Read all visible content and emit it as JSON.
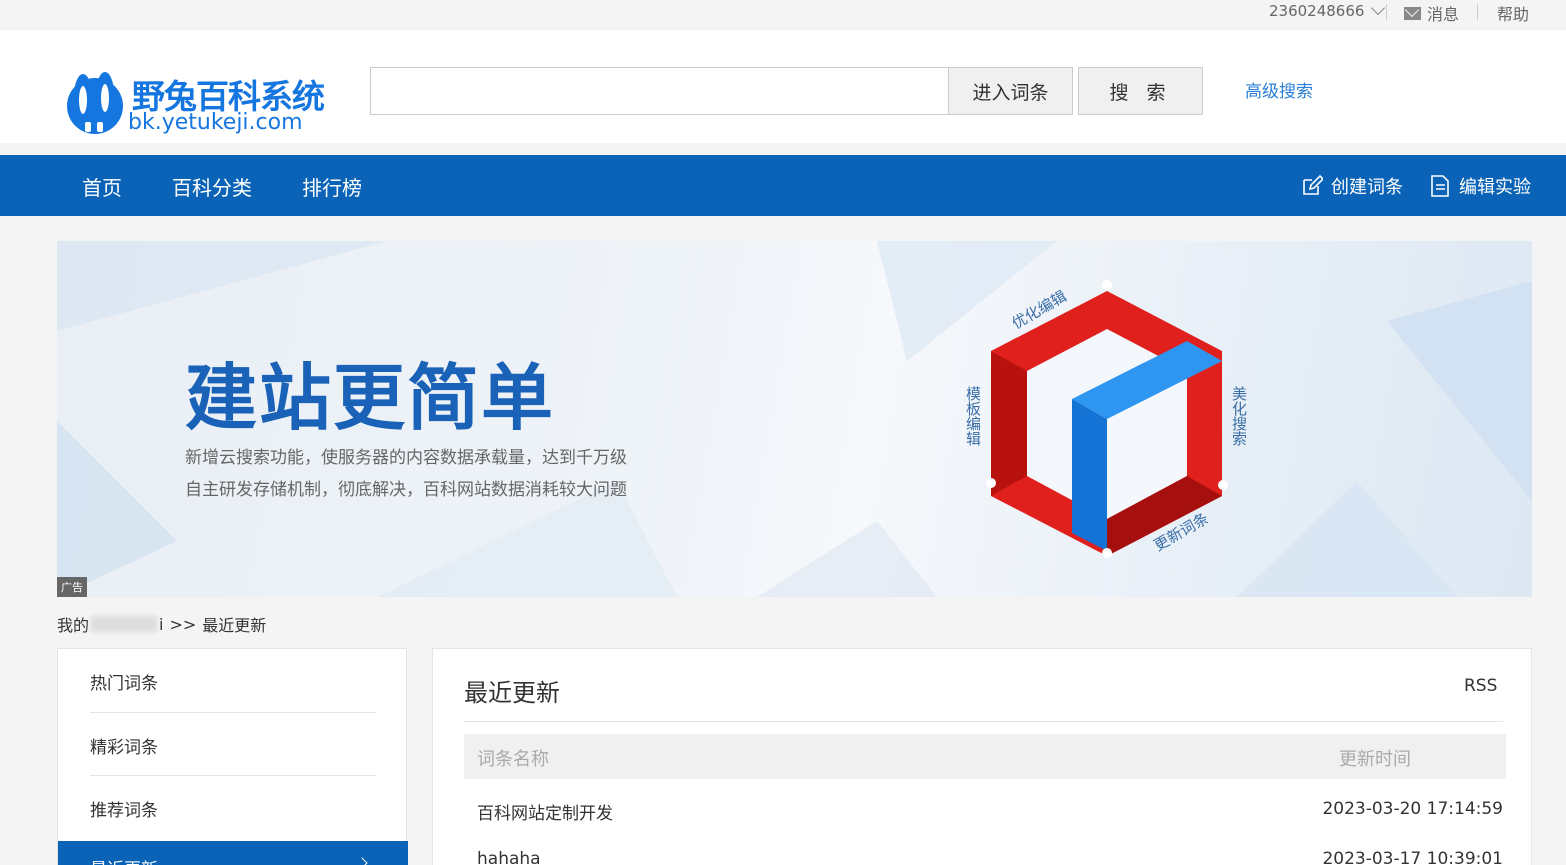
{
  "topbar": {
    "user_id": "2360248666",
    "messages": "消息",
    "help": "帮助"
  },
  "header": {
    "logo_title": "野兔百科系统",
    "logo_domain": "bk.yetukeji.com",
    "search_value": "",
    "enter_entry_label": "进入词条",
    "search_label": "搜 索",
    "advanced_search_label": "高级搜索"
  },
  "nav": {
    "items": [
      "首页",
      "百科分类",
      "排行榜"
    ],
    "create_entry": "创建词条",
    "edit_lab": "编辑实验"
  },
  "banner": {
    "headline": "建站更简单",
    "line1": "新增云搜索功能，使服务器的内容数据承载量，达到千万级",
    "line2": "自主研发存储机制，彻底解决，百科网站数据消耗较大问题",
    "cube_labels": [
      "优化编辑",
      "模板编辑",
      "美化搜索",
      "更新词条"
    ],
    "ad_tag": "广告",
    "colors": {
      "headline": "#1a62b8",
      "red": "#e0201c",
      "blue": "#1f86e8"
    }
  },
  "breadcrumb": {
    "first": "我的",
    "last_char": "i",
    "separator": ">>",
    "current": "最近更新"
  },
  "sidebar": {
    "items": [
      "热门词条",
      "精彩词条",
      "推荐词条",
      "最近更新"
    ]
  },
  "main": {
    "title": "最近更新",
    "rss": "RSS",
    "columns": [
      "词条名称",
      "更新时间"
    ],
    "rows": [
      {
        "name": "百科网站定制开发",
        "time": "2023-03-20 17:14:59"
      },
      {
        "name": "hahaha",
        "time": "2023-03-17 10:39:01"
      }
    ]
  },
  "colors": {
    "brand_blue": "#0a63b6",
    "link_blue": "#2a7fd4"
  }
}
